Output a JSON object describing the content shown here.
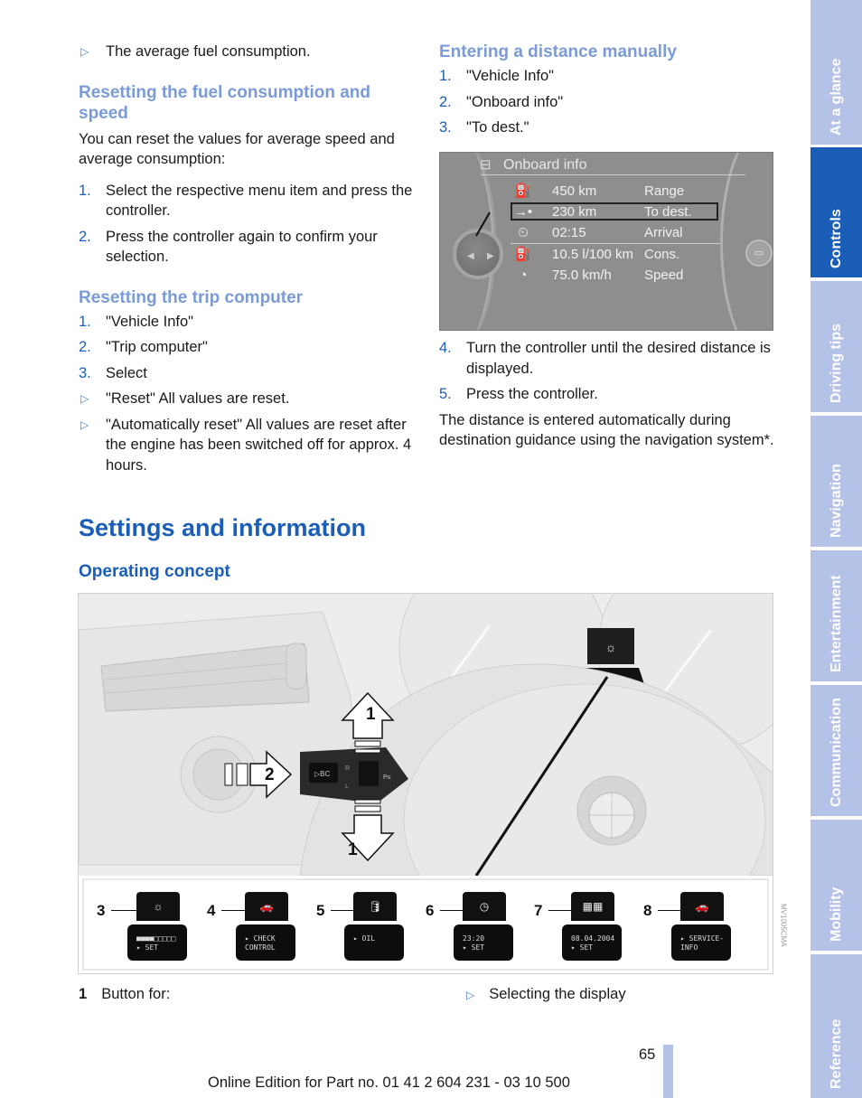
{
  "left_column": {
    "intro_bullet": "The average fuel consumption.",
    "section1": {
      "heading": "Resetting the fuel consumption and speed",
      "body": "You can reset the values for average speed and average consumption:",
      "steps": [
        {
          "num": "1.",
          "text": "Select the respective menu item and press the controller."
        },
        {
          "num": "2.",
          "text": "Press the controller again to confirm your selection."
        }
      ]
    },
    "section2": {
      "heading": "Resetting the trip computer",
      "steps": [
        {
          "num": "1.",
          "text": "\"Vehicle Info\""
        },
        {
          "num": "2.",
          "text": "\"Trip computer\""
        },
        {
          "num": "3.",
          "text": "Select"
        }
      ],
      "bullets": [
        "\"Reset\" All values are reset.",
        "\"Automatically reset\" All values are reset after the engine has been switched off for approx. 4 hours."
      ]
    }
  },
  "right_column": {
    "heading": "Entering a distance manually",
    "steps_a": [
      {
        "num": "1.",
        "text": "\"Vehicle Info\""
      },
      {
        "num": "2.",
        "text": "\"Onboard info\""
      },
      {
        "num": "3.",
        "text": "\"To dest.\""
      }
    ],
    "onboard_screen": {
      "title": "Onboard info",
      "title_icon": "car-info-icon",
      "rows": [
        {
          "icon": "fuel-range-icon",
          "glyph": "⛽",
          "value": "450  km",
          "label": "Range",
          "selected": false
        },
        {
          "icon": "arrow-to-dest-icon",
          "glyph": "→•",
          "value": "230  km",
          "label": "To dest.",
          "selected": true
        },
        {
          "icon": "arrival-clock-icon",
          "glyph": "⏲",
          "value": "02:15",
          "label": "Arrival",
          "selected": false
        },
        {
          "icon": "fuel-pump-icon",
          "glyph": "⛽",
          "value": "10.5 l/100 km",
          "label": "Cons.",
          "selected": false
        },
        {
          "icon": "speedometer-icon",
          "glyph": "◔",
          "value": "75.0 km/h",
          "label": "Speed",
          "selected": false
        }
      ],
      "right_button_icon": "display-toggle-icon"
    },
    "steps_b": [
      {
        "num": "4.",
        "text": "Turn the controller until the desired distance is displayed."
      },
      {
        "num": "5.",
        "text": "Press the controller."
      }
    ],
    "note": "The distance is entered automatically during destination guidance using the navigation system*."
  },
  "section_title": "Settings and information",
  "subsection_title": "Operating concept",
  "illustration": {
    "callouts": [
      "1",
      "2",
      "1"
    ],
    "stalk_button_label": "▷BC",
    "stalk_labels": {
      "r": "R",
      "l": "L",
      "pe": "P≤"
    },
    "displays": [
      {
        "num": "3",
        "icon": "light-speedo-icon",
        "glyph": "☼",
        "line1": "■■■■□□□□□",
        "line2": "▸ SET"
      },
      {
        "num": "4",
        "icon": "car-icon",
        "glyph": "🚗",
        "line1": "▸ CHECK",
        "line2": "CONTROL"
      },
      {
        "num": "5",
        "icon": "oil-can-icon",
        "glyph": "🛢",
        "line1": "",
        "line2": "▸    OIL"
      },
      {
        "num": "6",
        "icon": "clock-icon",
        "glyph": "◷",
        "line1": "23:20",
        "line2": "▸ SET"
      },
      {
        "num": "7",
        "icon": "calendar-icon",
        "glyph": "▦▦",
        "line1": "08.04.2004",
        "line2": "▸ SET"
      },
      {
        "num": "8",
        "icon": "car-service-icon",
        "glyph": "🚗",
        "line1": "▸ SERVICE-",
        "line2": "INFO"
      }
    ],
    "image_id": "MV1005CMA"
  },
  "legend": {
    "item1_num": "1",
    "item1_text": "Button for:",
    "bullet": "Selecting the display"
  },
  "page_number": "65",
  "footer": "Online Edition for Part no. 01 41 2 604 231 - 03 10 500",
  "sidebar_tabs": [
    {
      "label": "At a glance",
      "active": false
    },
    {
      "label": "Controls",
      "active": true
    },
    {
      "label": "Driving tips",
      "active": false
    },
    {
      "label": "Navigation",
      "active": false
    },
    {
      "label": "Entertainment",
      "active": false
    },
    {
      "label": "Communication",
      "active": false
    },
    {
      "label": "Mobility",
      "active": false
    },
    {
      "label": "Reference",
      "active": false
    }
  ],
  "colors": {
    "accent_dark": "#1a5eb8",
    "accent_light": "#7b9bd8",
    "tab_inactive": "#b3c2e6",
    "tab_active": "#1a5eb8"
  }
}
